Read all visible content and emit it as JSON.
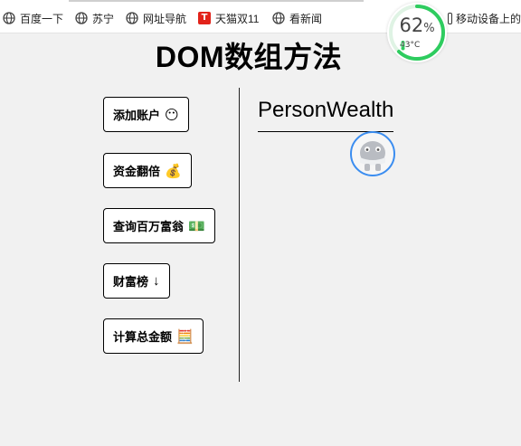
{
  "bookmarks": [
    {
      "label": "百度一下",
      "icon": "globe-icon"
    },
    {
      "label": "苏宁",
      "icon": "globe-icon"
    },
    {
      "label": "网址导航",
      "icon": "globe-icon"
    },
    {
      "label": "天猫双11",
      "icon": "tmall-icon",
      "icon_text": "T"
    },
    {
      "label": "看新闻",
      "icon": "globe-icon"
    },
    {
      "label": "移动设备上的",
      "icon": "phone-icon"
    }
  ],
  "gauge": {
    "value": "62",
    "unit": "%",
    "temperature": "43°C",
    "fraction": 0.62,
    "color": "#2ecc5f"
  },
  "page": {
    "title": "DOM数组方法"
  },
  "buttons": [
    {
      "label": "添加账户",
      "emoji": "😶"
    },
    {
      "label": "资金翻倍",
      "emoji": "💰"
    },
    {
      "label": "查询百万富翁",
      "emoji": "💵"
    },
    {
      "label": "财富榜",
      "emoji": "↓"
    },
    {
      "label": "计算总金额",
      "emoji": "🧮"
    }
  ],
  "wealth": {
    "header": "PersonWealth"
  },
  "colors": {
    "accent_border": "#3b8df0"
  }
}
